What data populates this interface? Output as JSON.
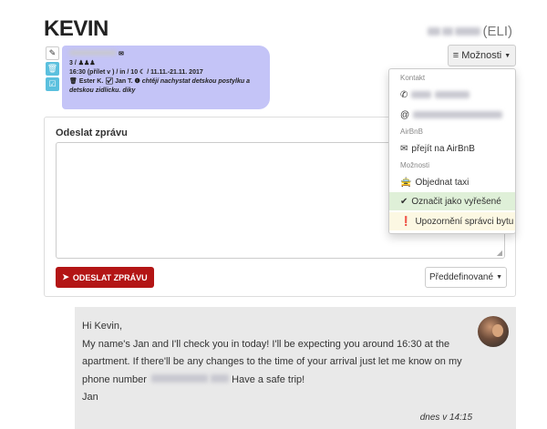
{
  "header": {
    "title": "KEVIN",
    "user_suffix": "(ELI)"
  },
  "side_icons": [
    "edit-icon",
    "trash-icon",
    "check-square-icon"
  ],
  "reservation": {
    "guests": "3 / ♟♟♟",
    "time_line": "16:30 (přílet v ) / in / 10 ☾ / 11.11.-21.11. 2017",
    "people": "🗑 Ester K. ☑ Jan T. ❶",
    "note": "chtějí nachystat detskou postylku a detskou zidlicku. diky"
  },
  "options_button": {
    "label": "Možnosti",
    "icon": "hamburger-icon"
  },
  "compose": {
    "label": "Odeslat zprávu",
    "textarea_value": "",
    "send_label": "ODESLAT ZPRÁVU",
    "predefined_label": "Předdefinované"
  },
  "dropdown": {
    "contact_header": "Kontakt",
    "airbnb_header": "AirBnB",
    "airbnb_link": "přejít na AirBnB",
    "options_header": "Možnosti",
    "taxi": "Objednat taxi",
    "resolved": "Označit jako vyřešené",
    "notify": "Upozornění správci bytu"
  },
  "message": {
    "lines": [
      "Hi Kevin,",
      "My name's Jan and I'll check you in today! I'll be expecting you around 16:30 at the",
      "apartment. If there'll be any changes to the time of your arrival just let me know on my",
      "phone number",
      "Have a safe trip!",
      "Jan"
    ],
    "time": "dnes v 14:15"
  },
  "colors": {
    "accent_red": "#b31515",
    "reservation_bg": "#c4c4f7",
    "success_bg": "#dff0d8",
    "warning_bg": "#fcf8e3",
    "info_icon": "#5bc0de"
  }
}
